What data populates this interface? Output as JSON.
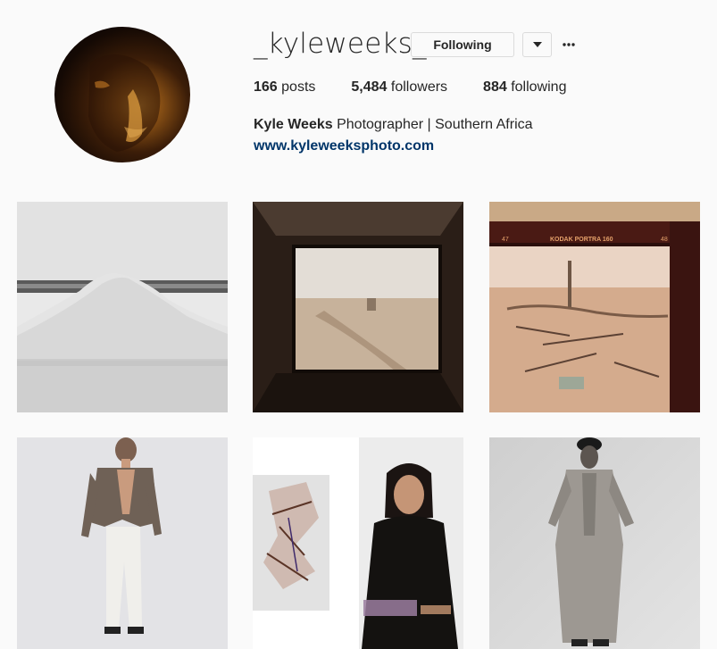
{
  "profile": {
    "username": "_kyleweeks_",
    "follow_button_label": "Following",
    "dropdown_icon": "caret-down-icon",
    "more_icon": "ellipsis-icon",
    "stats": {
      "posts_count": "166",
      "posts_label": "posts",
      "followers_count": "5,484",
      "followers_label": "followers",
      "following_count": "884",
      "following_label": "following"
    },
    "full_name": "Kyle Weeks",
    "bio": "Photographer | Southern Africa",
    "website": "www.kyleweeksphoto.com"
  },
  "posts": {
    "film_strip_text": {
      "frame_left": "47",
      "brand": "KODAK PORTRA 160",
      "frame_right": "48"
    }
  },
  "colors": {
    "link": "#003569",
    "text": "#262626",
    "background": "#fafafa",
    "border": "#dbdbdb"
  }
}
